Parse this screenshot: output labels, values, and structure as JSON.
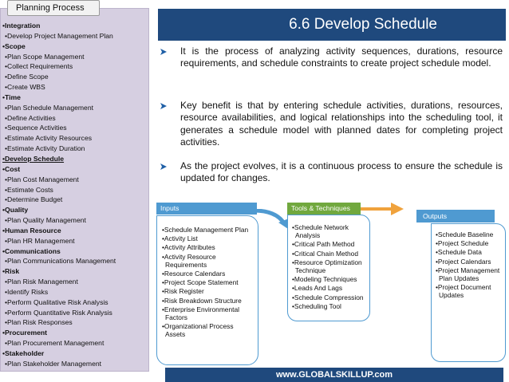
{
  "sidebar": {
    "tab_label": "Planning Process",
    "items": [
      {
        "text": "•Integration",
        "level": "h"
      },
      {
        "text": "•Develop Project Management Plan",
        "level": "s"
      },
      {
        "text": "•Scope",
        "level": "h"
      },
      {
        "text": "•Plan Scope Management",
        "level": "s"
      },
      {
        "text": "•Collect Requirements",
        "level": "s"
      },
      {
        "text": "•Define Scope",
        "level": "s"
      },
      {
        "text": "•Create WBS",
        "level": "s"
      },
      {
        "text": "•Time",
        "level": "h"
      },
      {
        "text": "•Plan Schedule Management",
        "level": "s"
      },
      {
        "text": "•Define Activities",
        "level": "s"
      },
      {
        "text": "•Sequence Activities",
        "level": "s"
      },
      {
        "text": "•Estimate Activity Resources",
        "level": "s"
      },
      {
        "text": "•Estimate Activity Duration",
        "level": "s"
      },
      {
        "text": "•Develop Schedule",
        "level": "cur"
      },
      {
        "text": "•Cost",
        "level": "h"
      },
      {
        "text": "•Plan Cost Management",
        "level": "s"
      },
      {
        "text": "•Estimate Costs",
        "level": "s"
      },
      {
        "text": "•Determine Budget",
        "level": "s"
      },
      {
        "text": "•Quality",
        "level": "h"
      },
      {
        "text": "•Plan Quality Management",
        "level": "s"
      },
      {
        "text": "•Human Resource",
        "level": "h"
      },
      {
        "text": "•Plan HR Management",
        "level": "s"
      },
      {
        "text": "•Communications",
        "level": "h"
      },
      {
        "text": "•Plan Communications Management",
        "level": "s"
      },
      {
        "text": "•Risk",
        "level": "h"
      },
      {
        "text": "•Plan Risk Management",
        "level": "s"
      },
      {
        "text": "•Identify Risks",
        "level": "s"
      },
      {
        "text": "•Perform Qualitative Risk Analysis",
        "level": "s"
      },
      {
        "text": "•Perform Quantitative Risk Analysis",
        "level": "s"
      },
      {
        "text": "•Plan Risk Responses",
        "level": "s"
      },
      {
        "text": "•Procurement",
        "level": "h"
      },
      {
        "text": "•Plan Procurement Management",
        "level": "s"
      },
      {
        "text": "•Stakeholder",
        "level": "h"
      },
      {
        "text": "•Plan Stakeholder Management",
        "level": "s"
      }
    ]
  },
  "title": "6.6 Develop Schedule",
  "bullets": [
    "It is the process of analyzing activity sequences, durations, resource requirements, and schedule constraints to create project schedule model.",
    "Key benefit is that by entering schedule activities, durations, resources, resource availabilities, and logical relationships into the scheduling tool, it generates a schedule model with planned dates for completing project activities.",
    "As the project evolves, it is a continuous process to ensure the schedule is updated for changes."
  ],
  "process": {
    "inputs": {
      "label": "Inputs",
      "items": [
        "•Schedule Management Plan",
        "•Activity List",
        "•Activity Attributes",
        "•Activity Resource Requirements",
        "•Resource Calendars",
        "•Project Scope Statement",
        "•Risk Register",
        "•Risk Breakdown Structure",
        "•Enterprise Environmental Factors",
        "•Organizational Process Assets"
      ]
    },
    "tools": {
      "label": "Tools & Techniques",
      "items": [
        "•Schedule Network Analysis",
        "•Critical Path Method",
        "•Critical Chain Method",
        "•Resource Optimization Technique",
        "•Modeling Techniques",
        "•Leads And Lags",
        "•Schedule Compression",
        "•Scheduling Tool"
      ]
    },
    "outputs": {
      "label": "Outputs",
      "items": [
        "•Schedule Baseline",
        "•Project Schedule",
        "•Schedule Data",
        "•Project Calendars",
        "•Project Management Plan Updates",
        "•Project Document Updates"
      ]
    }
  },
  "footer": "www.GLOBALSKILLUP.com",
  "colors": {
    "sidebar_bg": "#d6cfe1",
    "title_bg": "#1f497d",
    "box_border": "#4f9ad1",
    "header_blue": "#4f9ad1",
    "header_green": "#71a83e",
    "arrow_orange": "#f0a23c"
  },
  "icons": {
    "bullet": "right-arrow-icon",
    "flow": "curved-arrow-icon"
  }
}
